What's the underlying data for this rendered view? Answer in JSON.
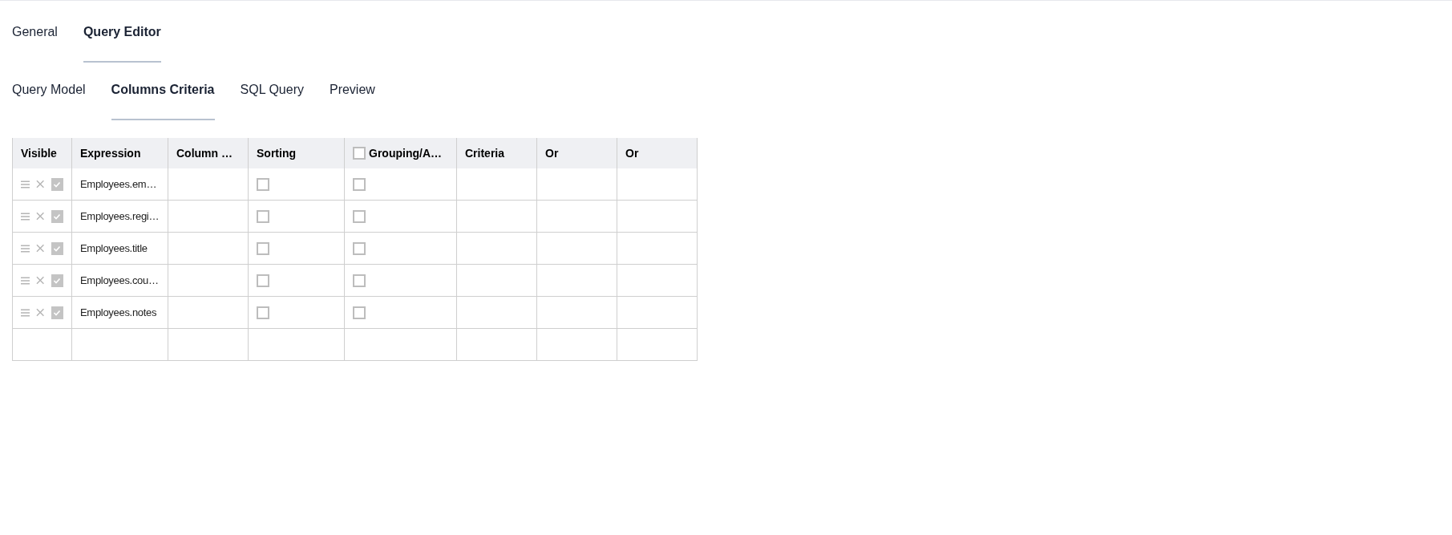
{
  "tabs": [
    {
      "label": "General",
      "selected": false
    },
    {
      "label": "Query Editor",
      "selected": true
    }
  ],
  "subtabs": [
    {
      "label": "Query Model",
      "selected": false
    },
    {
      "label": "Columns Criteria",
      "selected": true
    },
    {
      "label": "SQL Query",
      "selected": false
    },
    {
      "label": "Preview",
      "selected": false
    }
  ],
  "table": {
    "columns": [
      {
        "label": "Visible"
      },
      {
        "label": "Expression"
      },
      {
        "label": "Column …"
      },
      {
        "label": "Sorting"
      },
      {
        "label": "Grouping/A…",
        "checked": false
      },
      {
        "label": "Criteria"
      },
      {
        "label": "Or"
      },
      {
        "label": "Or"
      }
    ],
    "rows": [
      {
        "visible": true,
        "expression": "Employees.em…",
        "sorting": false,
        "grouping": false
      },
      {
        "visible": true,
        "expression": "Employees.regi…",
        "sorting": false,
        "grouping": false
      },
      {
        "visible": true,
        "expression": "Employees.title",
        "sorting": false,
        "grouping": false
      },
      {
        "visible": true,
        "expression": "Employees.cou…",
        "sorting": false,
        "grouping": false
      },
      {
        "visible": true,
        "expression": "Employees.notes",
        "sorting": false,
        "grouping": false
      }
    ]
  }
}
